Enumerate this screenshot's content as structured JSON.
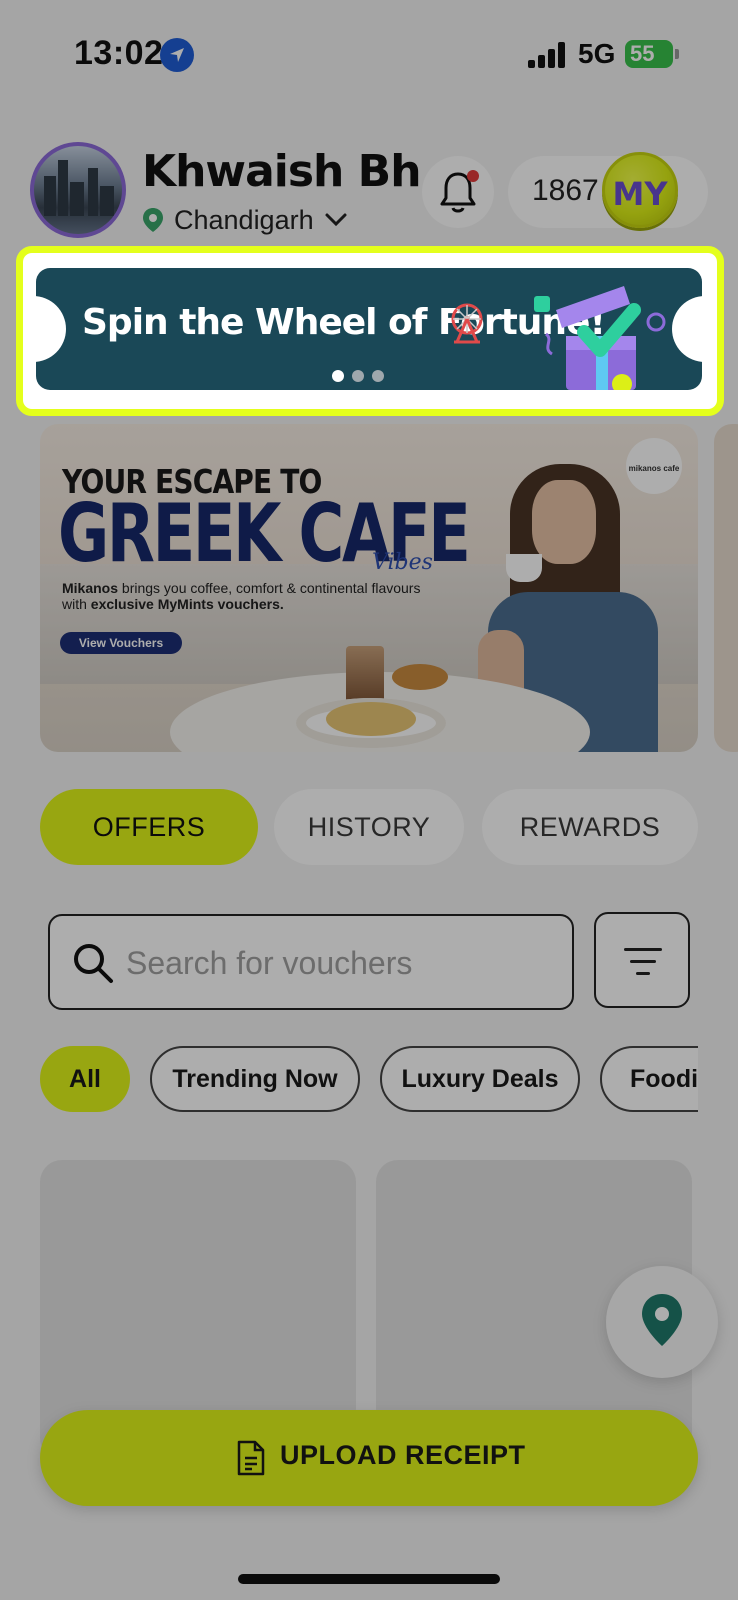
{
  "status_bar": {
    "time": "13:02",
    "network": "5G",
    "battery": "55"
  },
  "header": {
    "user_name": "Khwaish Bhas...",
    "city": "Chandigarh",
    "points": "1867",
    "coin_label": "MY"
  },
  "spin_banner": {
    "title": "Spin the Wheel of Fortune!",
    "slides": 3,
    "active_slide": 1,
    "colors": {
      "card": "#1a4857",
      "highlight": "#e4ff1c"
    }
  },
  "promo": {
    "logo_text": "mikanos cafe",
    "headline_top": "YOUR ESCAPE TO",
    "headline_big": "GREEK CAFE",
    "headline_script": "Vibes",
    "desc_brand": "Mikanos",
    "desc_mid": " brings you coffee, comfort & continental flavours with ",
    "desc_bold": "exclusive MyMints vouchers.",
    "button": "View Vouchers"
  },
  "tabs": [
    {
      "label": "OFFERS",
      "active": true
    },
    {
      "label": "HISTORY",
      "active": false
    },
    {
      "label": "REWARDS",
      "active": false
    }
  ],
  "search": {
    "placeholder": "Search for vouchers"
  },
  "chips": [
    {
      "label": "All",
      "active": true
    },
    {
      "label": "Trending Now",
      "active": false
    },
    {
      "label": "Luxury Deals",
      "active": false
    },
    {
      "label": "Foodie",
      "active": false
    }
  ],
  "upload": {
    "label": "UPLOAD RECEIPT"
  },
  "colors": {
    "accent": "#e1f51a",
    "brand_purple": "#6b4fd0",
    "promo_navy": "#17286b"
  }
}
